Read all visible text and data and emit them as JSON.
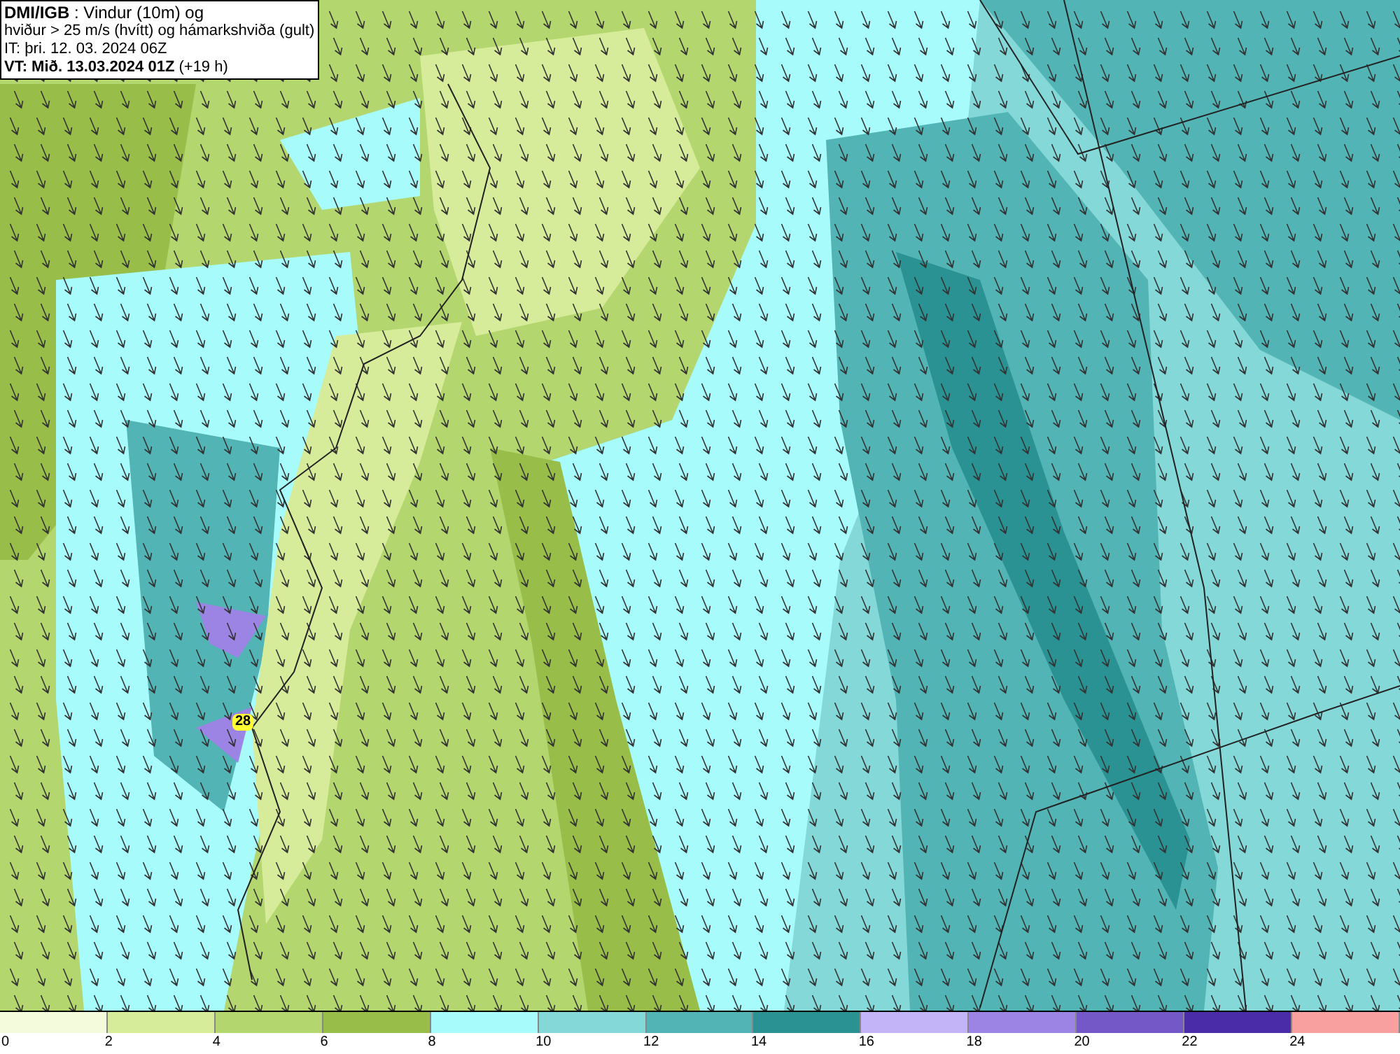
{
  "header": {
    "lines": [
      "**DMI/IGB** : Vindur (10m) og",
      "hviður > 25 m/s (hvítt) og hámarkshviða (gult)",
      "IT: þri. 12. 03. 2024 06Z",
      "**VT: Mið. 13.03.2024 01Z** (+19 h)"
    ]
  },
  "map": {
    "marker": "28"
  },
  "legend": {
    "bins": [
      {
        "color": "#f4fbdc"
      },
      {
        "color": "#d6ec9a"
      },
      {
        "color": "#b4d66e"
      },
      {
        "color": "#98bd48"
      },
      {
        "color": "#a8fbfb"
      },
      {
        "color": "#84d8d8"
      },
      {
        "color": "#52b4b4"
      },
      {
        "color": "#2a9292"
      },
      {
        "color": "#c3b4f8"
      },
      {
        "color": "#9c84e4"
      },
      {
        "color": "#7458c8"
      },
      {
        "color": "#4a2ca8"
      },
      {
        "color": "#f8a0a0"
      }
    ],
    "ticks": [
      "0",
      "2",
      "4",
      "6",
      "8",
      "10",
      "12",
      "14",
      "16",
      "18",
      "20",
      "22",
      "24"
    ]
  }
}
